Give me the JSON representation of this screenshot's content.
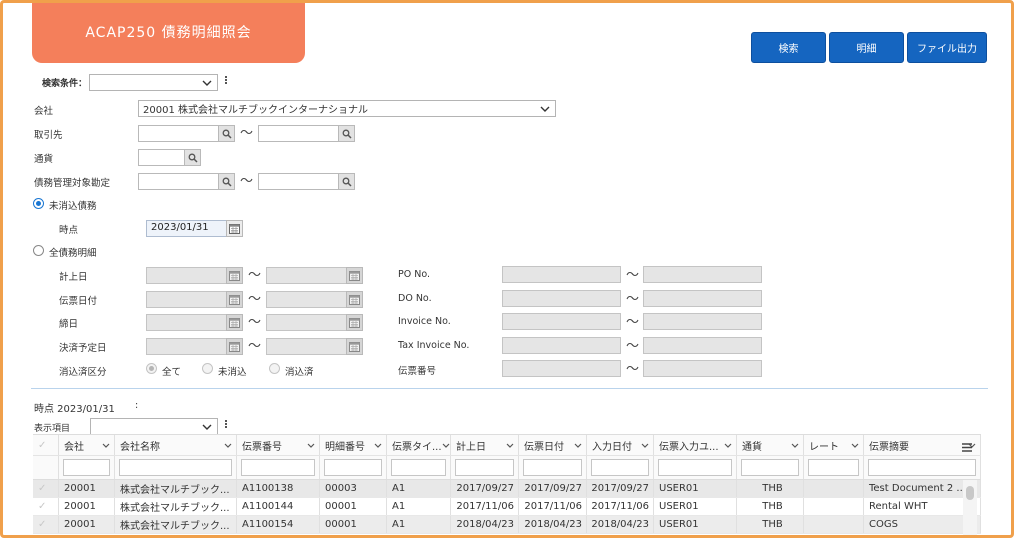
{
  "app": {
    "title": "ACAP250 債務明細照会"
  },
  "toolbar": {
    "search_label": "検索",
    "detail_label": "明細",
    "export_label": "ファイル出力"
  },
  "criteria": {
    "label": "検索条件：",
    "value": ""
  },
  "form": {
    "company_label": "会社",
    "company_value": "20001 株式会社マルチブックインターナショナル",
    "partner_label": "取引先",
    "currency_label": "通貨",
    "account_label": "債務管理対象勘定",
    "tilde": "〜",
    "opt_outstanding_label": "未消込債務",
    "point_label": "時点",
    "point_value": "2023/01/31",
    "opt_all_label": "全債務明細",
    "posting_date_label": "計上日",
    "slip_date_label": "伝票日付",
    "closing_date_label": "締日",
    "settlement_date_label": "決済予定日",
    "clearing_label": "消込済区分",
    "clearing_all": "全て",
    "clearing_open": "未消込",
    "clearing_done": "消込済",
    "po_label": "PO No.",
    "do_label": "DO No.",
    "invoice_label": "Invoice No.",
    "tax_invoice_label": "Tax Invoice No.",
    "slip_no_label": "伝票番号"
  },
  "results": {
    "heading": "時点 2023/01/31",
    "colon": ":",
    "display_label": "表示項目",
    "display_value": "",
    "columns": [
      "会社",
      "会社名称",
      "伝票番号",
      "明細番号",
      "伝票タイ...",
      "計上日",
      "伝票日付",
      "入力日付",
      "伝票入力ユ...",
      "通貨",
      "レート",
      "伝票摘要"
    ],
    "rows": [
      [
        "20001",
        "株式会社マルチブック...",
        "A1100138",
        "00003",
        "A1",
        "2017/09/27",
        "2017/09/27",
        "2017/09/27",
        "USER01",
        "THB",
        "",
        "Test Document 2 ..."
      ],
      [
        "20001",
        "株式会社マルチブック...",
        "A1100144",
        "00001",
        "A1",
        "2017/11/06",
        "2017/11/06",
        "2017/11/06",
        "USER01",
        "THB",
        "",
        "Rental WHT"
      ],
      [
        "20001",
        "株式会社マルチブック...",
        "A1100154",
        "00001",
        "A1",
        "2018/04/23",
        "2018/04/23",
        "2018/04/23",
        "USER01",
        "THB",
        "",
        "COGS"
      ]
    ]
  },
  "icons": {
    "search": "search-icon",
    "calendar": "calendar-icon",
    "chevron": "chevron-down-icon",
    "menu": "hamburger-menu-icon"
  },
  "colors": {
    "title_tab": "#f47f5b",
    "frame": "#f0a04b",
    "button": "#1565c0",
    "radio": "#1976d2"
  }
}
